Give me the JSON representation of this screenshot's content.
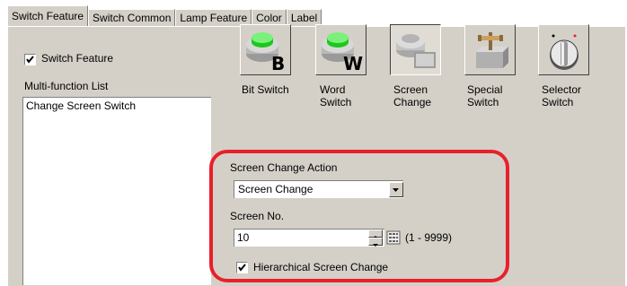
{
  "tabs": [
    "Switch Feature",
    "Switch Common",
    "Lamp Feature",
    "Color",
    "Label"
  ],
  "switch_feature": {
    "checkbox_label": "Switch Feature",
    "checked": true
  },
  "multi_function": {
    "label": "Multi-function List",
    "items": [
      "Change Screen Switch"
    ]
  },
  "switch_types": [
    {
      "line1": "Bit Switch",
      "line2": "",
      "icon": "green-button-b-icon",
      "pressed": false
    },
    {
      "line1": "Word",
      "line2": "Switch",
      "icon": "green-button-w-icon",
      "pressed": false
    },
    {
      "line1": "Screen",
      "line2": "Change",
      "icon": "screen-change-icon",
      "pressed": true
    },
    {
      "line1": "Special",
      "line2": "Switch",
      "icon": "special-switch-icon",
      "pressed": false
    },
    {
      "line1": "Selector",
      "line2": "Switch",
      "icon": "selector-knob-icon",
      "pressed": false
    }
  ],
  "screen_change": {
    "action_label": "Screen Change Action",
    "action_value": "Screen Change",
    "screen_no_label": "Screen No.",
    "screen_no_value": "10",
    "range_text": "(1 - 9999)",
    "hierarchical_label": "Hierarchical Screen Change",
    "hierarchical_checked": true
  },
  "highlight_color": "#e8202a"
}
